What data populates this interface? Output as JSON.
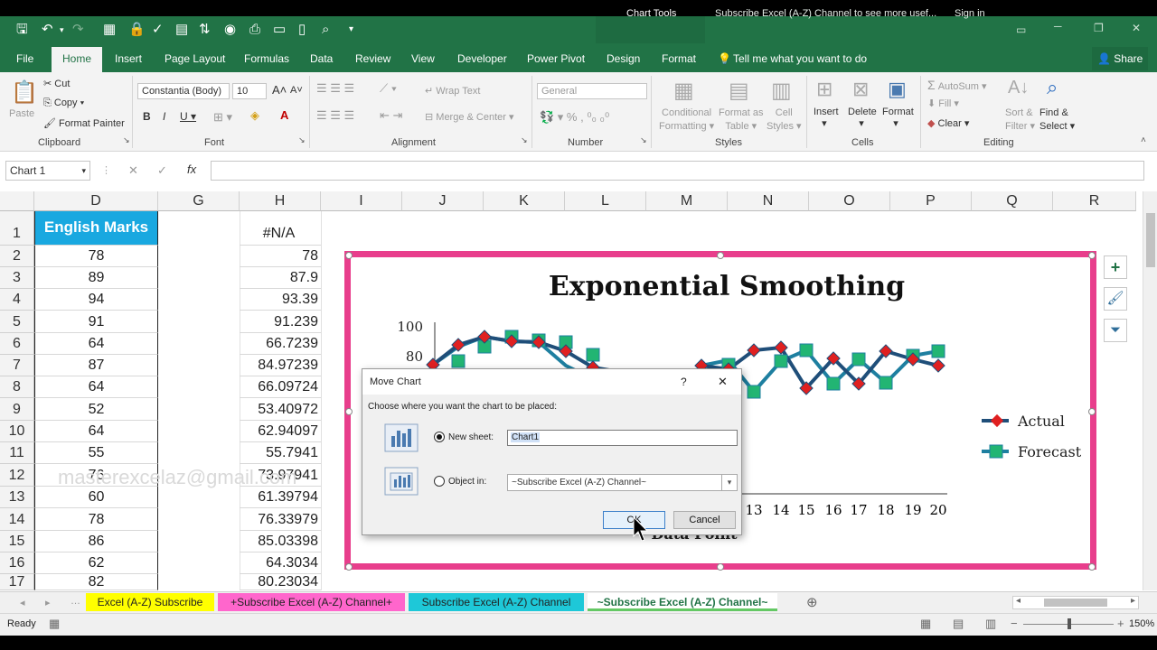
{
  "title": {
    "chart_tools": "Chart Tools",
    "subscribe": "Subscribe Excel (A-Z) Channel to see more usef...",
    "sign_in": "Sign in"
  },
  "tabs": [
    "File",
    "Home",
    "Insert",
    "Page Layout",
    "Formulas",
    "Data",
    "Review",
    "View",
    "Developer",
    "Power Pivot",
    "Design",
    "Format"
  ],
  "tell_me": "Tell me what you want to do",
  "share": "Share",
  "ribbon": {
    "paste": "Paste",
    "cut": "Cut",
    "copy": "Copy",
    "format_painter": "Format Painter",
    "clipboard": "Clipboard",
    "font_name": "Constantia (Body)",
    "font_size": "10",
    "font": "Font",
    "wrap_text": "Wrap Text",
    "merge_center": "Merge & Center",
    "alignment": "Alignment",
    "number_format": "General",
    "number": "Number",
    "conditional_formatting": "Conditional Formatting",
    "format_as_table": "Format as Table",
    "cell_styles": "Cell Styles",
    "styles": "Styles",
    "insert": "Insert",
    "delete": "Delete",
    "format": "Format",
    "cells": "Cells",
    "autosum": "AutoSum",
    "fill": "Fill",
    "clear": "Clear",
    "sort_filter": "Sort & Filter",
    "find_select": "Find & Select",
    "editing": "Editing"
  },
  "namebox": "Chart 1",
  "columns": [
    "D",
    "G",
    "H",
    "I",
    "J",
    "K",
    "L",
    "M",
    "N",
    "O",
    "P",
    "Q",
    "R"
  ],
  "rows": [
    "1",
    "2",
    "3",
    "4",
    "5",
    "6",
    "7",
    "8",
    "9",
    "10",
    "11",
    "12",
    "13",
    "14",
    "15",
    "16",
    "17"
  ],
  "colD_header": "English Marks",
  "colH_header": "#N/A",
  "colD": [
    "78",
    "89",
    "94",
    "91",
    "64",
    "87",
    "64",
    "52",
    "64",
    "55",
    "76",
    "60",
    "78",
    "86",
    "62",
    "82"
  ],
  "colH": [
    "78",
    "87.9",
    "93.39",
    "91.239",
    "66.7239",
    "84.97239",
    "66.09724",
    "53.40972",
    "62.94097",
    "55.7941",
    "73.97941",
    "61.39794",
    "76.33979",
    "85.03398",
    "64.3034",
    "80.23034"
  ],
  "watermark": "masterexcelaz@gmail.com",
  "chart_data": {
    "type": "line",
    "title": "Exponential Smoothing",
    "xlabel": "Data Point",
    "x_ticks_visible": [
      "13",
      "14",
      "15",
      "16",
      "17",
      "18",
      "19",
      "20"
    ],
    "y_ticks_visible": [
      "100",
      "80"
    ],
    "series": [
      {
        "name": "Actual",
        "color": "#1f4e79",
        "marker": "diamond-red"
      },
      {
        "name": "Forecast",
        "color": "#1f7f9a",
        "marker": "square-green"
      }
    ]
  },
  "dialog": {
    "title": "Move Chart",
    "help": "?",
    "close": "✕",
    "prompt": "Choose where you want the chart to be placed:",
    "new_sheet_label": "New sheet:",
    "new_sheet_value": "Chart1",
    "object_in_label": "Object in:",
    "object_in_value": "~Subscribe Excel (A-Z) Channel~",
    "ok": "OK",
    "cancel": "Cancel"
  },
  "sheets": [
    {
      "label": "Excel (A-Z) Subscribe",
      "color": "#ffff00"
    },
    {
      "label": "+Subscribe Excel (A-Z) Channel+",
      "color": "#ff66cc"
    },
    {
      "label": "Subscribe Excel (A-Z) Channel",
      "color": "#1ec8d8"
    },
    {
      "label": "~Subscribe Excel (A-Z) Channel~",
      "color": "#c8f0c8"
    }
  ],
  "status": {
    "ready": "Ready",
    "zoom": "150%"
  }
}
